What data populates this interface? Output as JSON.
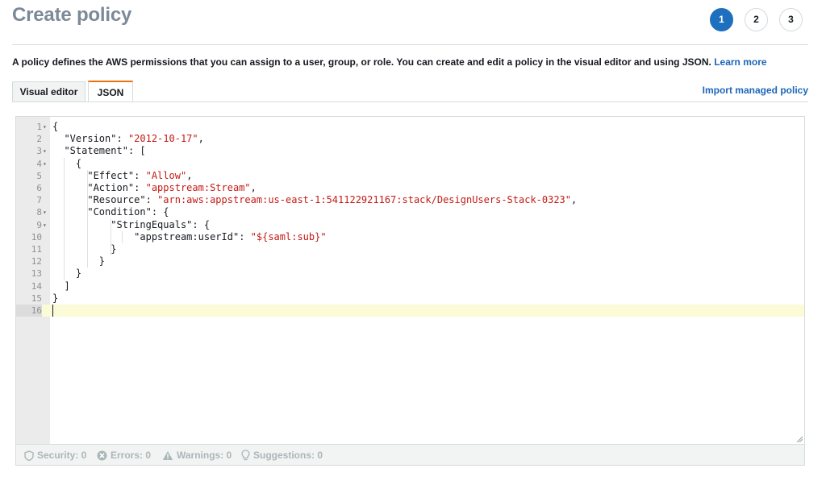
{
  "header": {
    "title": "Create policy",
    "steps": [
      "1",
      "2",
      "3"
    ],
    "active_step": "1"
  },
  "description": {
    "text": "A policy defines the AWS permissions that you can assign to a user, group, or role. You can create and edit a policy in the visual editor and using JSON.",
    "learn_more": "Learn more"
  },
  "tabs": [
    {
      "label": "Visual editor",
      "active": false
    },
    {
      "label": "JSON",
      "active": true
    }
  ],
  "import_link": "Import managed policy",
  "editor": {
    "lines": [
      "{",
      "  \"Version\": \"2012-10-17\",",
      "  \"Statement\": [",
      "    {",
      "      \"Effect\": \"Allow\",",
      "      \"Action\": \"appstream:Stream\",",
      "      \"Resource\": \"arn:aws:appstream:us-east-1:541122921167:stack/DesignUsers-Stack-0323\",",
      "      \"Condition\": {",
      "          \"StringEquals\": {",
      "              \"appstream:userId\": \"${saml:sub}\"",
      "          }",
      "        }",
      "    }",
      "  ]",
      "}",
      ""
    ],
    "fold_lines": [
      1,
      3,
      4,
      8,
      9
    ],
    "current_line": 16
  },
  "status_bar": {
    "security": "Security: 0",
    "errors": "Errors: 0",
    "warnings": "Warnings: 0",
    "suggestions": "Suggestions: 0"
  },
  "colors": {
    "accent": "#1f6fbf",
    "tab_active_border": "#ec7211",
    "link": "#1c66b8",
    "string": "#c41a16"
  }
}
